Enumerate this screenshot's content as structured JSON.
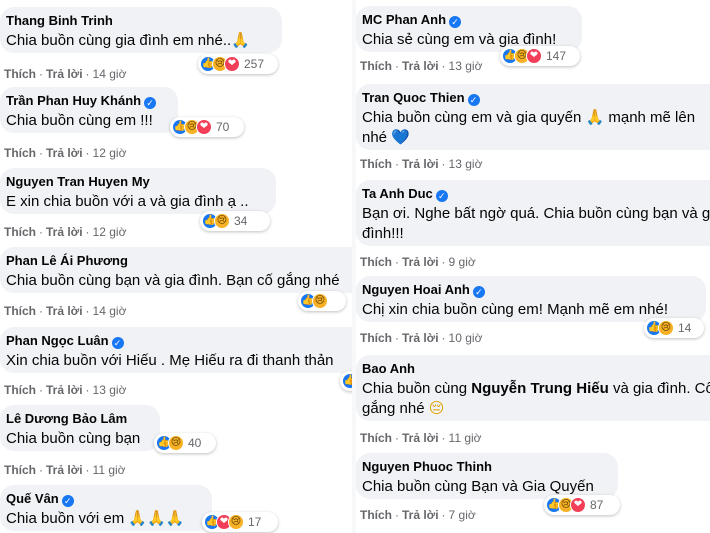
{
  "actions": {
    "like": "Thích",
    "reply": "Trả lời",
    "separator": "·"
  },
  "left_comments": [
    {
      "author": "Thang Binh Trinh",
      "verified": false,
      "text": "Chia buồn cùng gia đình em nhé..",
      "emoji": "🙏",
      "time": "14 giờ",
      "reactions": [
        "like",
        "sad",
        "love"
      ],
      "count": "257"
    },
    {
      "author": "Trần Phan Huy Khánh",
      "verified": true,
      "text": "Chia buồn cùng em !!!",
      "time": "12 giờ",
      "reactions": [
        "like",
        "sad",
        "love"
      ],
      "count": "70"
    },
    {
      "author": "Nguyen Tran Huyen My",
      "verified": false,
      "text": "E xin chia buồn với a và gia đình ạ ..",
      "time": "12 giờ",
      "reactions": [
        "like",
        "sad"
      ],
      "count": "34"
    },
    {
      "author": "Phan Lê Ái Phương",
      "verified": false,
      "text": "Chia buồn cùng bạn và gia đình. Bạn cố gắng nhé",
      "time": "14 giờ",
      "reactions": [
        "like",
        "sad"
      ],
      "count": ""
    },
    {
      "author": "Phan Ngọc Luân",
      "verified": true,
      "text": "Xin chia buồn với Hiếu . Mẹ Hiếu ra đi thanh thản",
      "time": "13 giờ",
      "reactions": [
        "like"
      ],
      "count": ""
    },
    {
      "author": "Lê Dương Bảo Lâm",
      "verified": false,
      "text": "Chia buồn cùng bạn",
      "time": "11 giờ",
      "reactions": [
        "like",
        "sad"
      ],
      "count": "40"
    },
    {
      "author": "Quế Vân",
      "verified": true,
      "text": "Chia buồn với em",
      "emoji": "🙏🙏🙏",
      "time": "",
      "reactions": [
        "like",
        "love",
        "sad"
      ],
      "count": "17"
    }
  ],
  "right_comments": [
    {
      "author": "MC Phan Anh",
      "verified": true,
      "text": "Chia sẻ cùng em và gia đình!",
      "time": "13 giờ",
      "reactions": [
        "like",
        "sad",
        "love"
      ],
      "count": "147"
    },
    {
      "author": "Tran Quoc Thien",
      "verified": true,
      "text": "Chia buồn cùng em và gia quyến",
      "emoji": "🙏",
      "text2": "mạnh mẽ lên",
      "line2": "nhé",
      "emoji2": "💙",
      "time": "13 giờ"
    },
    {
      "author": "Ta Anh Duc",
      "verified": true,
      "text": "Bạn ơi. Nghe bất ngờ quá. Chia buồn cùng bạn và gia",
      "line2": "đình!!!",
      "time": "9 giờ"
    },
    {
      "author": "Nguyen Hoai Anh",
      "verified": true,
      "text": "Chị xin chia buồn cùng em! Mạnh mẽ em nhé!",
      "time": "10 giờ",
      "reactions": [
        "like",
        "sad"
      ],
      "count": "14"
    },
    {
      "author": "Bao Anh",
      "verified": false,
      "text": "Chia buồn cùng",
      "bold": "Nguyễn Trung Hiếu",
      "text2": "và gia đình. Cố",
      "line2": "gắng nhé",
      "emoji2": "😔",
      "time": "11 giờ"
    },
    {
      "author": "Nguyen Phuoc Thinh",
      "verified": false,
      "text": "Chia buồn cùng Bạn và Gia Quyến",
      "time": "7 giờ",
      "reactions": [
        "like",
        "sad",
        "love"
      ],
      "count": "87"
    }
  ],
  "reaction_icons": {
    "like": "👍",
    "sad": "😢",
    "love": "❤"
  }
}
